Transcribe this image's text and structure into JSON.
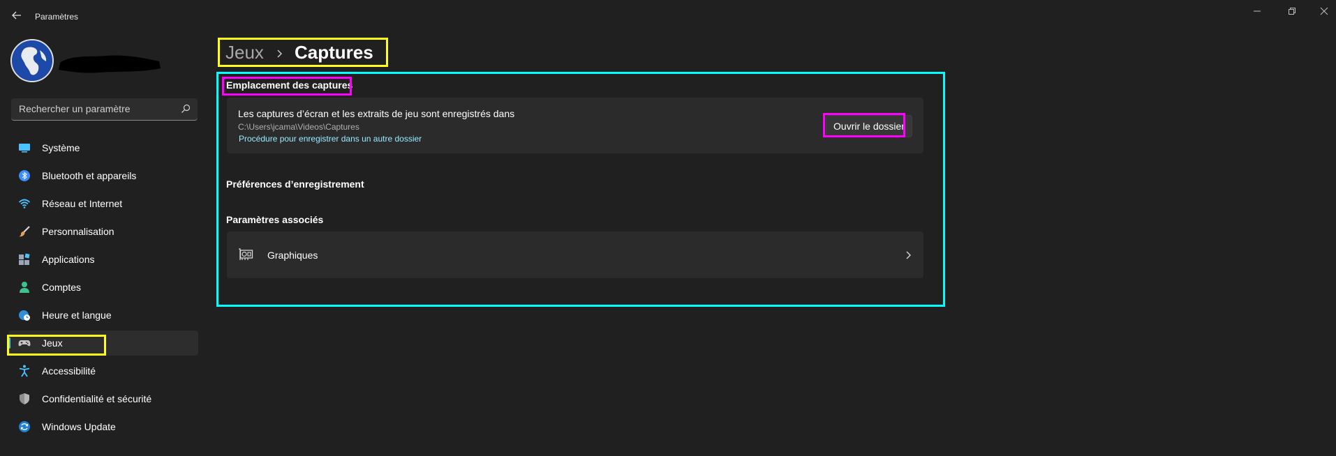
{
  "window": {
    "title": "Paramètres",
    "controls": [
      "minimize-icon",
      "restore-icon",
      "close-icon"
    ]
  },
  "search": {
    "placeholder": "Rechercher un paramètre"
  },
  "sidebar": {
    "items": [
      {
        "label": "Système",
        "icon": "monitor-icon",
        "color": "#4cc2ff"
      },
      {
        "label": "Bluetooth et appareils",
        "icon": "bluetooth-icon",
        "color": "#3a8cff"
      },
      {
        "label": "Réseau et Internet",
        "icon": "wifi-icon",
        "color": "#4cc2ff"
      },
      {
        "label": "Personnalisation",
        "icon": "brush-icon",
        "color": "#e8a050"
      },
      {
        "label": "Applications",
        "icon": "apps-icon",
        "color": "#9aa7b8"
      },
      {
        "label": "Comptes",
        "icon": "person-icon",
        "color": "#3fc08c"
      },
      {
        "label": "Heure et langue",
        "icon": "globe-clock-icon",
        "color": "#4cc2ff"
      },
      {
        "label": "Jeux",
        "icon": "gamepad-icon",
        "color": "#b8b8b8",
        "active": true
      },
      {
        "label": "Accessibilité",
        "icon": "accessibility-icon",
        "color": "#4cc2ff"
      },
      {
        "label": "Confidentialité et sécurité",
        "icon": "shield-icon",
        "color": "#9a9a9a"
      },
      {
        "label": "Windows Update",
        "icon": "refresh-icon",
        "color": "#4cc2ff"
      }
    ]
  },
  "breadcrumb": {
    "parent": "Jeux",
    "current": "Captures"
  },
  "capture_location": {
    "section_title": "Emplacement des captures",
    "description": "Les captures d’écran et les extraits de jeu sont enregistrés dans",
    "path": "C:\\Users\\jcama\\Videos\\Captures",
    "link": "Procédure pour enregistrer dans un autre dossier",
    "button": "Ouvrir le dossier"
  },
  "recording_prefs": {
    "section_title": "Préférences d’enregistrement"
  },
  "related": {
    "section_title": "Paramètres associés",
    "items": [
      {
        "label": "Graphiques",
        "icon": "graphics-card-icon"
      }
    ]
  },
  "colors": {
    "background": "#202020",
    "card": "#2b2b2b",
    "accent": "#4cc2ff",
    "link": "#99ebff",
    "annotation_yellow": "#ffff1a",
    "annotation_cyan": "#00ffff",
    "annotation_magenta": "#ff00ff"
  }
}
